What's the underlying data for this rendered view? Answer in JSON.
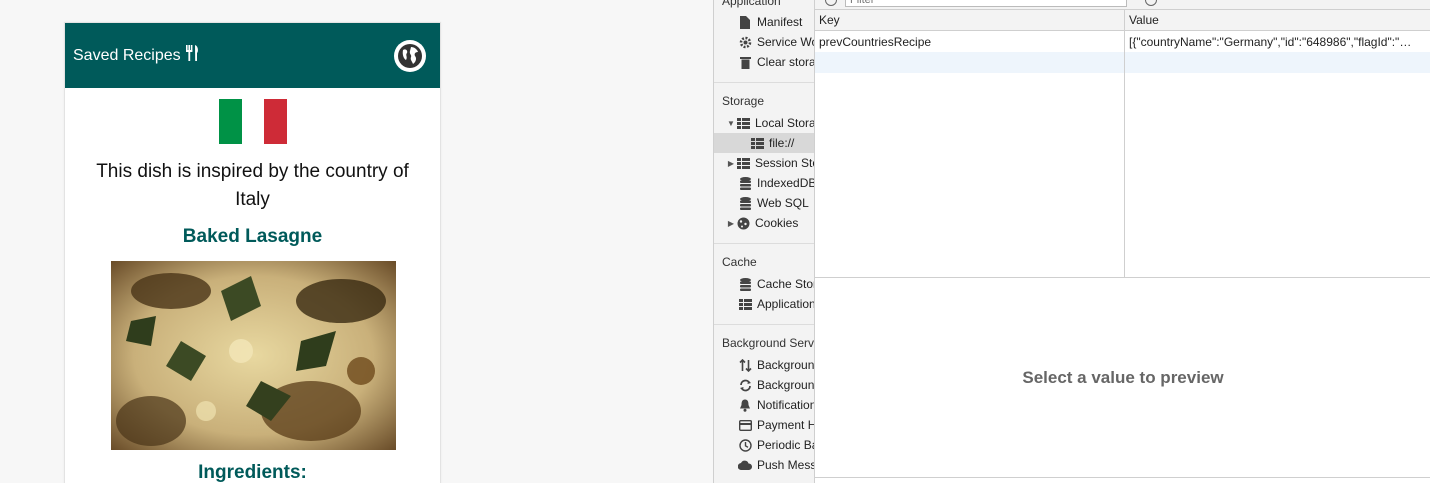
{
  "app": {
    "title": "Saved Recipes",
    "inspired_text": "This dish is inspired by the country of Italy",
    "recipe_title": "Baked Lasagne",
    "ingredients_heading": "Ingredients:",
    "colors": {
      "brand": "#005a5a",
      "flag_green": "#009246",
      "flag_white": "#ffffff",
      "flag_red": "#ce2b37"
    }
  },
  "devtools": {
    "sidebar": {
      "sections": {
        "application": "Application",
        "storage": "Storage",
        "cache": "Cache",
        "background": "Background Services"
      },
      "application_items": [
        {
          "label": "Manifest",
          "icon": "file-icon"
        },
        {
          "label": "Service Workers",
          "icon": "gear-icon"
        },
        {
          "label": "Clear storage",
          "icon": "trash-icon"
        }
      ],
      "storage_items": [
        {
          "label": "Local Storage",
          "icon": "grid-icon",
          "expanded": true
        },
        {
          "label": "file://",
          "icon": "grid-icon",
          "selected": true
        },
        {
          "label": "Session Storage",
          "icon": "grid-icon"
        },
        {
          "label": "IndexedDB",
          "icon": "database-icon"
        },
        {
          "label": "Web SQL",
          "icon": "database-icon"
        },
        {
          "label": "Cookies",
          "icon": "cookie-icon"
        }
      ],
      "cache_items": [
        {
          "label": "Cache Storage",
          "icon": "database-icon"
        },
        {
          "label": "Application Cache",
          "icon": "grid-icon"
        }
      ],
      "background_items": [
        {
          "label": "Background Fetch",
          "icon": "updown-arrows-icon"
        },
        {
          "label": "Background Sync",
          "icon": "sync-icon"
        },
        {
          "label": "Notifications",
          "icon": "bell-icon"
        },
        {
          "label": "Payment Handler",
          "icon": "card-icon"
        },
        {
          "label": "Periodic Background Sync",
          "icon": "clock-icon"
        },
        {
          "label": "Push Messaging",
          "icon": "cloud-icon"
        }
      ]
    },
    "toolbar": {
      "filter_placeholder": "Filter"
    },
    "table": {
      "headers": {
        "key": "Key",
        "value": "Value"
      },
      "rows": [
        {
          "key": "prevCountriesRecipe",
          "value": "[{\"countryName\":\"Germany\",\"id\":\"648986\",\"flagId\":\"…"
        }
      ]
    },
    "preview_text": "Select a value to preview"
  }
}
